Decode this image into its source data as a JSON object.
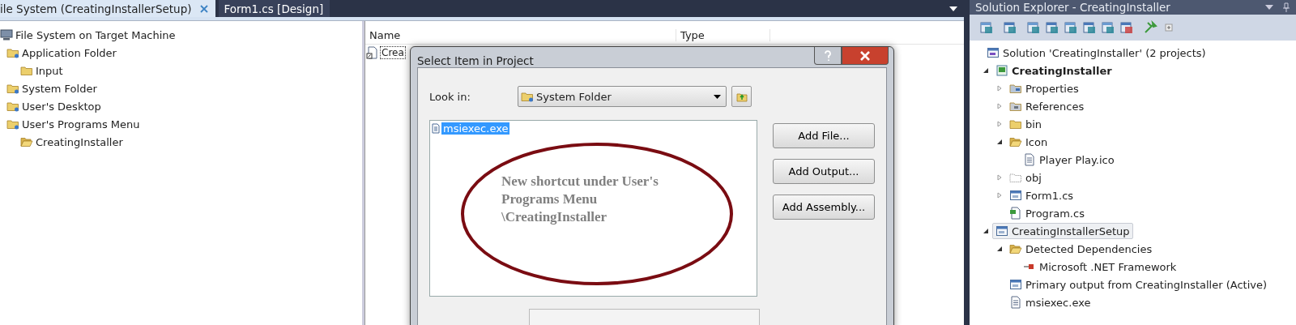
{
  "tabs": [
    {
      "label": "ile System (CreatingInstallerSetup)",
      "selected": true,
      "closable": true
    },
    {
      "label": "Form1.cs [Design]",
      "selected": false,
      "closable": false
    }
  ],
  "file_system_tree": [
    {
      "label": "File System on Target Machine",
      "kind": "machine",
      "children": [
        {
          "label": "Application Folder",
          "kind": "special-folder",
          "children": [
            {
              "label": "Input",
              "kind": "folder"
            }
          ]
        },
        {
          "label": "System Folder",
          "kind": "special-folder"
        },
        {
          "label": "User's Desktop",
          "kind": "special-folder"
        },
        {
          "label": "User's Programs Menu",
          "kind": "special-folder",
          "children": [
            {
              "label": "CreatingInstaller",
              "kind": "open-folder"
            }
          ]
        }
      ]
    }
  ],
  "file_list": {
    "columns": [
      "Name",
      "Type"
    ],
    "rows": [
      {
        "name": "Crea"
      }
    ]
  },
  "dialog": {
    "title": "Select Item in Project",
    "look_in_label": "Look in:",
    "look_in_value": "System Folder",
    "items": [
      {
        "label": "msiexec.exe",
        "selected": true
      }
    ],
    "buttons": [
      "Add File...",
      "Add Output...",
      "Add Assembly..."
    ]
  },
  "annotation": "New shortcut under User's Programs Menu \\CreatingInstaller",
  "solution_explorer": {
    "title": "Solution Explorer - CreatingInstaller",
    "tree": [
      {
        "label": "Solution 'CreatingInstaller' (2 projects)",
        "kind": "solution",
        "selected": false,
        "children": [
          {
            "label": "CreatingInstaller",
            "kind": "cs-project",
            "bold": true,
            "expanded": true,
            "selected": false,
            "children": [
              {
                "label": "Properties",
                "kind": "properties",
                "expanded": false,
                "selected": false
              },
              {
                "label": "References",
                "kind": "references",
                "expanded": false,
                "selected": false
              },
              {
                "label": "bin",
                "kind": "folder",
                "expanded": false,
                "selected": false
              },
              {
                "label": "Icon",
                "kind": "open-folder",
                "expanded": true,
                "selected": false,
                "children": [
                  {
                    "label": "Player Play.ico",
                    "kind": "image-file",
                    "selected": false
                  }
                ]
              },
              {
                "label": "obj",
                "kind": "empty-folder",
                "expanded": false,
                "selected": false
              },
              {
                "label": "Form1.cs",
                "kind": "form",
                "expanded": false,
                "selected": false
              },
              {
                "label": "Program.cs",
                "kind": "cs-file",
                "selected": false
              }
            ]
          },
          {
            "label": "CreatingInstallerSetup",
            "kind": "setup-project",
            "bold": false,
            "expanded": true,
            "selected": true,
            "children": [
              {
                "label": "Detected Dependencies",
                "kind": "open-folder",
                "expanded": true,
                "selected": false,
                "children": [
                  {
                    "label": "Microsoft .NET Framework",
                    "kind": "dependency",
                    "selected": false
                  }
                ]
              },
              {
                "label": "Primary output from CreatingInstaller (Active)",
                "kind": "output",
                "selected": false
              },
              {
                "label": "msiexec.exe",
                "kind": "file",
                "selected": false
              }
            ]
          }
        ]
      }
    ]
  }
}
